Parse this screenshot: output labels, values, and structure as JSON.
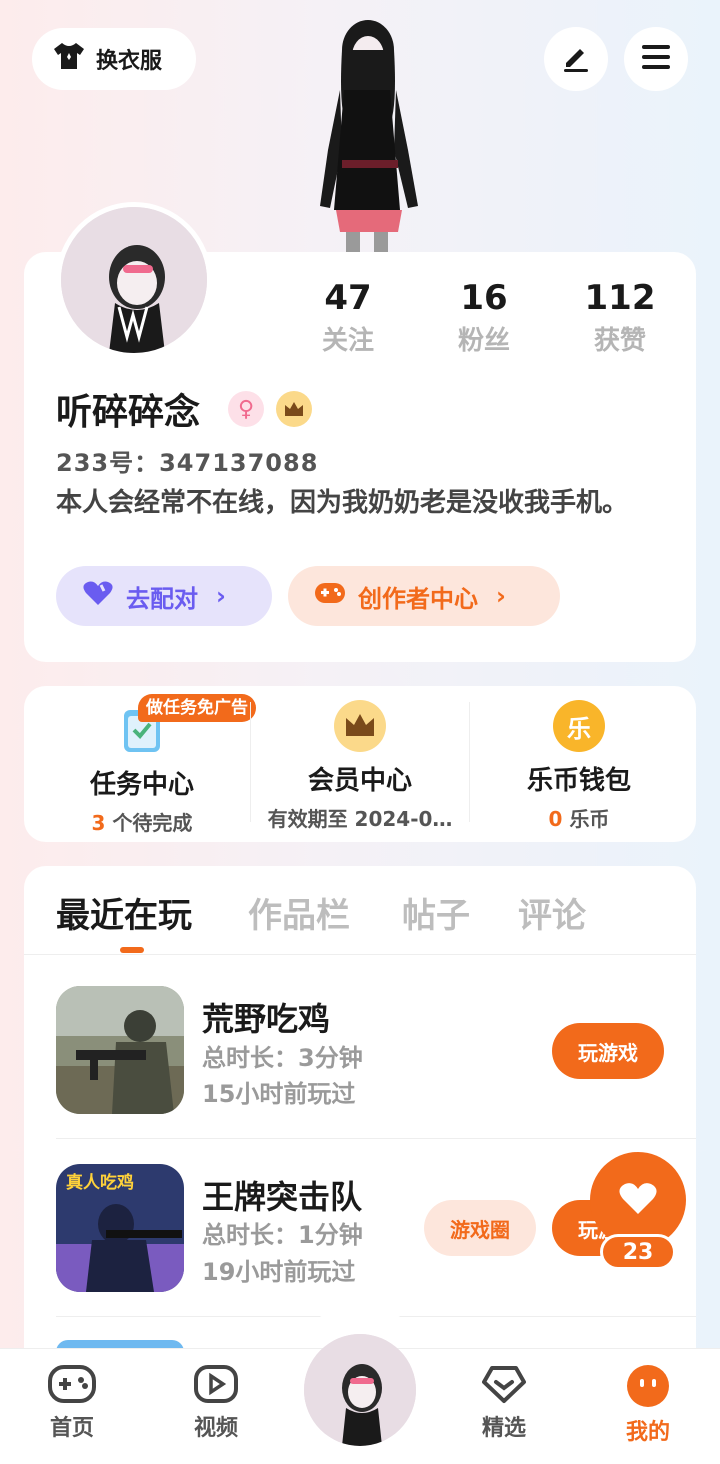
{
  "top_bar": {
    "dress_label": "换衣服"
  },
  "profile": {
    "stats": [
      {
        "value": "47",
        "label": "关注"
      },
      {
        "value": "16",
        "label": "粉丝"
      },
      {
        "value": "112",
        "label": "获赞"
      }
    ],
    "username": "听碎碎念",
    "gender_symbol": "♀",
    "uid_label": "233号：",
    "uid": "347137088",
    "bio": "本人会经常不在线，因为我奶奶老是没收我手机。",
    "match_label": "去配对",
    "creator_label": "创作者中心"
  },
  "services": {
    "task_tag": "做任务免广告",
    "items": [
      {
        "title": "任务中心",
        "count": "3",
        "sub": "个待完成"
      },
      {
        "title": "会员中心",
        "count": "",
        "sub": "有效期至 2024-0…"
      },
      {
        "title": "乐币钱包",
        "count": "0",
        "sub": "乐币",
        "icon_char": "乐"
      }
    ]
  },
  "tabs": [
    "最近在玩",
    "作品栏",
    "帖子",
    "评论"
  ],
  "games": [
    {
      "name": "荒野吃鸡",
      "duration": "总时长：3分钟",
      "last_played": "15小时前玩过",
      "play_label": "玩游戏"
    },
    {
      "name": "王牌突击队",
      "duration": "总时长：1分钟",
      "last_played": "19小时前玩过",
      "circle_label": "游戏圈",
      "play_label": "玩游戏",
      "icon_text": "真人吃鸡"
    }
  ],
  "like": {
    "count": "23"
  },
  "bottom_nav": [
    {
      "label": "首页",
      "icon": "gamepad-icon"
    },
    {
      "label": "视频",
      "icon": "video-icon"
    },
    {
      "label": "精选",
      "icon": "heart-diamond-icon"
    },
    {
      "label": "我的",
      "icon": "face-icon",
      "active": true
    }
  ],
  "colors": {
    "accent": "#f26a1b",
    "match": "#6a5cf0"
  }
}
